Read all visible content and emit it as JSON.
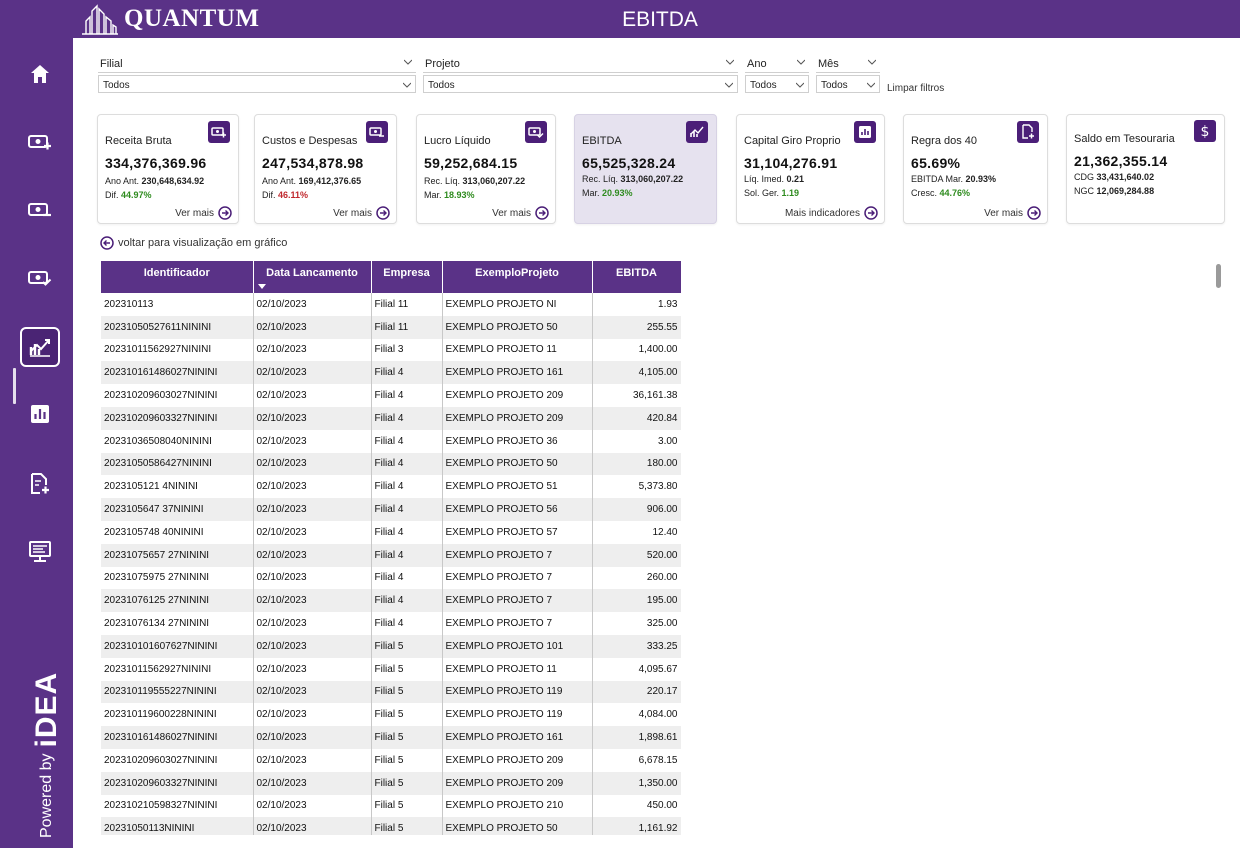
{
  "app": {
    "brand": "QUANTUM",
    "title": "EBITDA",
    "powered_by": "Powered by",
    "powered_brand": "iDEA"
  },
  "sidebar": {
    "items": [
      {
        "icon": "home-icon"
      },
      {
        "icon": "cash-plus-icon"
      },
      {
        "icon": "cash-minus-icon"
      },
      {
        "icon": "cash-check-icon"
      },
      {
        "icon": "ebitda-chart-icon",
        "active": true
      },
      {
        "icon": "bar-chart-icon"
      },
      {
        "icon": "document-plus-icon"
      },
      {
        "icon": "presentation-icon"
      }
    ]
  },
  "filters": {
    "filial": {
      "label": "Filial",
      "value": "Todos"
    },
    "projeto": {
      "label": "Projeto",
      "value": "Todos"
    },
    "ano": {
      "label": "Ano",
      "value": "Todos"
    },
    "mes": {
      "label": "Mês",
      "value": "Todos"
    },
    "clear": "Limpar filtros"
  },
  "cards": {
    "receita": {
      "title": "Receita Bruta",
      "value": "334,376,369.96",
      "l1": "Ano Ant.",
      "l1v": "230,648,634.92",
      "l2": "Dif.",
      "l2v": "44.97%",
      "more": "Ver mais"
    },
    "custos": {
      "title": "Custos e Despesas",
      "value": "247,534,878.98",
      "l1": "Ano Ant.",
      "l1v": "169,412,376.65",
      "l2": "Dif.",
      "l2v": "46.11%",
      "more": "Ver mais"
    },
    "lucro": {
      "title": "Lucro Líquido",
      "value": "59,252,684.15",
      "l1": "Rec. Líq.",
      "l1v": "313,060,207.22",
      "l2": "Mar.",
      "l2v": "18.93%",
      "more": "Ver mais"
    },
    "ebitda": {
      "title": "EBITDA",
      "value": "65,525,328.24",
      "l1": "Rec. Líq.",
      "l1v": "313,060,207.22",
      "l2": "Mar.",
      "l2v": "20.93%"
    },
    "capital": {
      "title": "Capital Giro Proprio",
      "value": "31,104,276.91",
      "l1": "Líq. Imed.",
      "l1v": "0.21",
      "l2": "Sol. Ger.",
      "l2v": "1.19",
      "more": "Mais indicadores"
    },
    "regra": {
      "title": "Regra dos 40",
      "value": "65.69%",
      "l1": "EBITDA Mar.",
      "l1v": "20.93%",
      "l2": "Cresc.",
      "l2v": "44.76%",
      "more": "Ver mais"
    },
    "saldo": {
      "title": "Saldo em Tesouraria",
      "value": "21,362,355.14",
      "l1": "CDG",
      "l1v": "33,431,640.02",
      "l2": "NGC",
      "l2v": "12,069,284.88"
    }
  },
  "back_link": "voltar para visualização em gráfico",
  "table": {
    "columns": [
      "Identificador",
      "Data Lancamento",
      "Empresa",
      "ExemploProjeto",
      "EBITDA"
    ],
    "rows": [
      [
        "202310113",
        "02/10/2023",
        "Filial 11",
        "EXEMPLO PROJETO NI",
        "1.93"
      ],
      [
        "20231050527611NININI",
        "02/10/2023",
        "Filial 11",
        "EXEMPLO PROJETO 50",
        "255.55"
      ],
      [
        "20231011562927NININI",
        "02/10/2023",
        "Filial 3",
        "EXEMPLO PROJETO 11",
        "1,400.00"
      ],
      [
        "202310161486027NININI",
        "02/10/2023",
        "Filial 4",
        "EXEMPLO PROJETO 161",
        "4,105.00"
      ],
      [
        "202310209603027NININI",
        "02/10/2023",
        "Filial 4",
        "EXEMPLO PROJETO 209",
        "36,161.38"
      ],
      [
        "202310209603327NININI",
        "02/10/2023",
        "Filial 4",
        "EXEMPLO PROJETO 209",
        "420.84"
      ],
      [
        "20231036508040NININI",
        "02/10/2023",
        "Filial 4",
        "EXEMPLO PROJETO 36",
        "3.00"
      ],
      [
        "20231050586427NININI",
        "02/10/2023",
        "Filial 4",
        "EXEMPLO PROJETO 50",
        "180.00"
      ],
      [
        "2023105121 4NININI",
        "02/10/2023",
        "Filial 4",
        "EXEMPLO PROJETO 51",
        "5,373.80"
      ],
      [
        "2023105647 37NININI",
        "02/10/2023",
        "Filial 4",
        "EXEMPLO PROJETO 56",
        "906.00"
      ],
      [
        "2023105748 40NININI",
        "02/10/2023",
        "Filial 4",
        "EXEMPLO PROJETO 57",
        "12.40"
      ],
      [
        "20231075657 27NININI",
        "02/10/2023",
        "Filial 4",
        "EXEMPLO PROJETO 7",
        "520.00"
      ],
      [
        "20231075975 27NININI",
        "02/10/2023",
        "Filial 4",
        "EXEMPLO PROJETO 7",
        "260.00"
      ],
      [
        "20231076125 27NININI",
        "02/10/2023",
        "Filial 4",
        "EXEMPLO PROJETO 7",
        "195.00"
      ],
      [
        "20231076134 27NININI",
        "02/10/2023",
        "Filial 4",
        "EXEMPLO PROJETO 7",
        "325.00"
      ],
      [
        "202310101607627NININI",
        "02/10/2023",
        "Filial 5",
        "EXEMPLO PROJETO 101",
        "333.25"
      ],
      [
        "20231011562927NININI",
        "02/10/2023",
        "Filial 5",
        "EXEMPLO PROJETO 11",
        "4,095.67"
      ],
      [
        "202310119555227NININI",
        "02/10/2023",
        "Filial 5",
        "EXEMPLO PROJETO 119",
        "220.17"
      ],
      [
        "202310119600228NININI",
        "02/10/2023",
        "Filial 5",
        "EXEMPLO PROJETO 119",
        "4,084.00"
      ],
      [
        "202310161486027NININI",
        "02/10/2023",
        "Filial 5",
        "EXEMPLO PROJETO 161",
        "1,898.61"
      ],
      [
        "202310209603027NININI",
        "02/10/2023",
        "Filial 5",
        "EXEMPLO PROJETO 209",
        "6,678.15"
      ],
      [
        "202310209603327NININI",
        "02/10/2023",
        "Filial 5",
        "EXEMPLO PROJETO 209",
        "1,350.00"
      ],
      [
        "202310210598327NININI",
        "02/10/2023",
        "Filial 5",
        "EXEMPLO PROJETO 210",
        "450.00"
      ],
      [
        "20231050113NININI",
        "02/10/2023",
        "Filial 5",
        "EXEMPLO PROJETO 50",
        "1,161.92"
      ]
    ]
  }
}
